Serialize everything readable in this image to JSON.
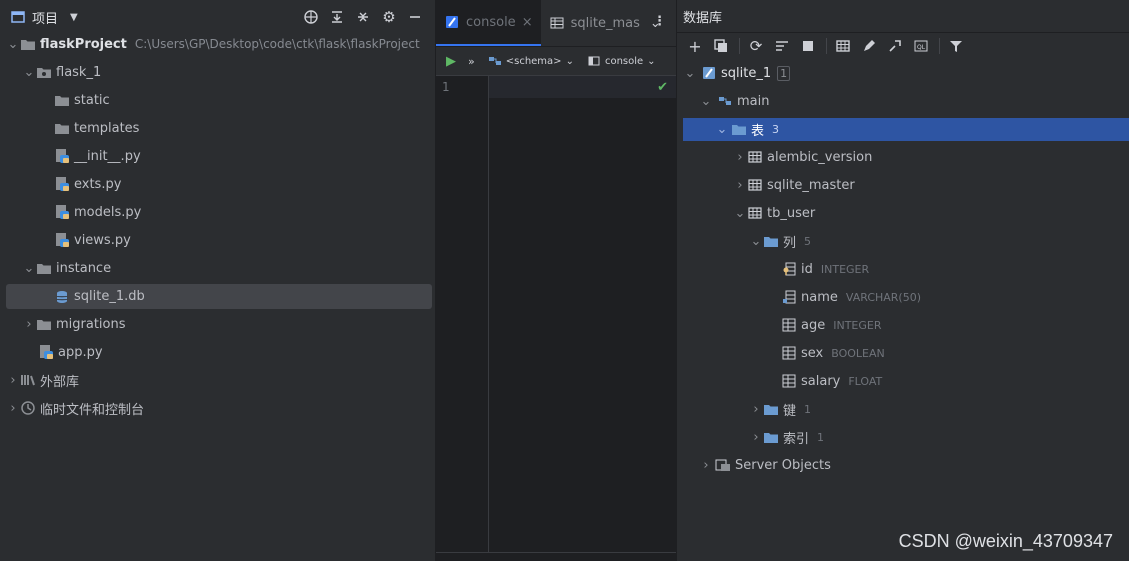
{
  "project": {
    "title": "项目",
    "tree": [
      {
        "label": "flaskProject",
        "path": "C:\\Users\\GP\\Desktop\\code\\ctk\\flask\\flaskProject",
        "icon": "folder-icon"
      },
      {
        "label": "flask_1",
        "icon": "package-icon"
      },
      {
        "label": "static",
        "icon": "folder-icon"
      },
      {
        "label": "templates",
        "icon": "folder-icon"
      },
      {
        "label": "__init__.py",
        "icon": "python-file-icon"
      },
      {
        "label": "exts.py",
        "icon": "python-file-icon"
      },
      {
        "label": "models.py",
        "icon": "python-file-icon"
      },
      {
        "label": "views.py",
        "icon": "python-file-icon"
      },
      {
        "label": "instance",
        "icon": "folder-icon"
      },
      {
        "label": "sqlite_1.db",
        "icon": "database-file-icon"
      },
      {
        "label": "migrations",
        "icon": "folder-icon"
      },
      {
        "label": "app.py",
        "icon": "python-file-icon"
      },
      {
        "label": "外部库",
        "icon": "library-icon"
      },
      {
        "label": "临时文件和控制台",
        "icon": "scratch-icon"
      }
    ]
  },
  "editor": {
    "tabs": [
      {
        "label": "console"
      },
      {
        "label": "sqlite_mas"
      }
    ],
    "schema_label": "<schema>",
    "console_label": "console",
    "line_number": "1"
  },
  "database": {
    "title": "数据库",
    "tree": [
      {
        "label": "sqlite_1",
        "badge": "1"
      },
      {
        "label": "main"
      },
      {
        "label": "表",
        "count": "3"
      },
      {
        "label": "alembic_version"
      },
      {
        "label": "sqlite_master"
      },
      {
        "label": "tb_user"
      },
      {
        "label": "列",
        "count": "5"
      },
      {
        "label": "id",
        "type": "INTEGER"
      },
      {
        "label": "name",
        "type": "VARCHAR(50)"
      },
      {
        "label": "age",
        "type": "INTEGER"
      },
      {
        "label": "sex",
        "type": "BOOLEAN"
      },
      {
        "label": "salary",
        "type": "FLOAT"
      },
      {
        "label": "键",
        "count": "1"
      },
      {
        "label": "索引",
        "count": "1"
      },
      {
        "label": "Server Objects"
      }
    ]
  },
  "watermark": "CSDN @weixin_43709347",
  "colors": {
    "accent": "#3574f0",
    "selection": "#2e55a3",
    "folder": "#6b9bd1",
    "python_yellow": "#e5c07b"
  }
}
